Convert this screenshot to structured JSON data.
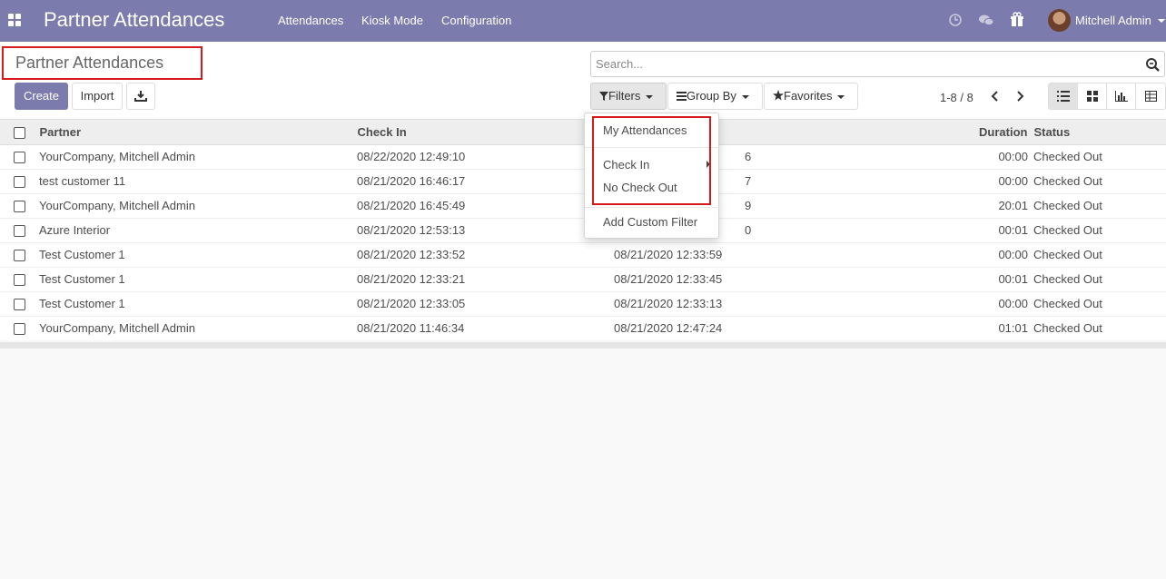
{
  "navbar": {
    "title": "Partner Attendances",
    "menus": [
      "Attendances",
      "Kiosk Mode",
      "Configuration"
    ],
    "user": "Mitchell Admin",
    "icons": [
      "apps-grid-icon",
      "clock-icon",
      "chat-icon",
      "gift-icon"
    ],
    "brand_color": "#7c7bad"
  },
  "breadcrumb": "Partner Attendances",
  "buttons": {
    "create": "Create",
    "import": "Import"
  },
  "search": {
    "placeholder": "Search..."
  },
  "filters": {
    "filters_label": "Filters",
    "group_by_label": "Group By",
    "favorites_label": "Favorites"
  },
  "pager": "1-8 / 8",
  "columns": {
    "partner": "Partner",
    "check_in": "Check In",
    "duration": "Duration",
    "status": "Status"
  },
  "rows": [
    {
      "partner": "YourCompany, Mitchell Admin",
      "check_in": "08/22/2020 12:49:10",
      "check_out": "",
      "check_out_partial": "6",
      "duration": "00:00",
      "status": "Checked Out"
    },
    {
      "partner": "test customer 11",
      "check_in": "08/21/2020 16:46:17",
      "check_out": "",
      "check_out_partial": "7",
      "duration": "00:00",
      "status": "Checked Out"
    },
    {
      "partner": "YourCompany, Mitchell Admin",
      "check_in": "08/21/2020 16:45:49",
      "check_out": "",
      "check_out_partial": "9",
      "duration": "20:01",
      "status": "Checked Out"
    },
    {
      "partner": "Azure Interior",
      "check_in": "08/21/2020 12:53:13",
      "check_out": "",
      "check_out_partial": "0",
      "duration": "00:01",
      "status": "Checked Out"
    },
    {
      "partner": "Test Customer 1",
      "check_in": "08/21/2020 12:33:52",
      "check_out": "08/21/2020 12:33:59",
      "check_out_partial": "",
      "duration": "00:00",
      "status": "Checked Out"
    },
    {
      "partner": "Test Customer 1",
      "check_in": "08/21/2020 12:33:21",
      "check_out": "08/21/2020 12:33:45",
      "check_out_partial": "",
      "duration": "00:01",
      "status": "Checked Out"
    },
    {
      "partner": "Test Customer 1",
      "check_in": "08/21/2020 12:33:05",
      "check_out": "08/21/2020 12:33:13",
      "check_out_partial": "",
      "duration": "00:00",
      "status": "Checked Out"
    },
    {
      "partner": "YourCompany, Mitchell Admin",
      "check_in": "08/21/2020 11:46:34",
      "check_out": "08/21/2020 12:47:24",
      "check_out_partial": "",
      "duration": "01:01",
      "status": "Checked Out"
    }
  ],
  "filter_dropdown": {
    "items": [
      "My Attendances",
      "Check In",
      "No Check Out",
      "Add Custom Filter"
    ]
  },
  "highlight_color": "#d71a1a"
}
